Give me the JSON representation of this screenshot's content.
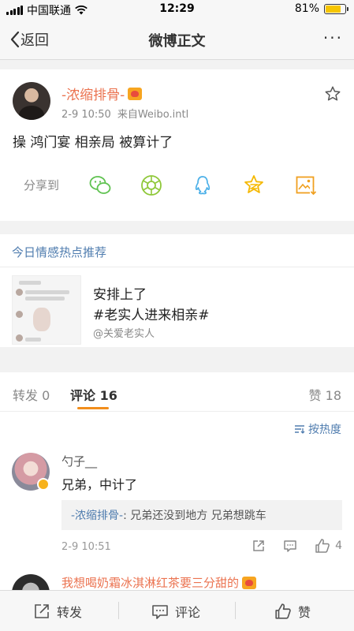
{
  "status_bar": {
    "carrier": "中国联通",
    "time": "12:29",
    "battery": "81%",
    "battery_level": 0.81
  },
  "nav": {
    "back_label": "返回",
    "title": "微博正文",
    "more": "···"
  },
  "post": {
    "username": "-浓缩排骨-",
    "time": "2-9 10:50",
    "source": "来自Weibo.intl",
    "text": "操 鸿门宴 相亲局 被算计了",
    "share_label": "分享到",
    "share_icons": [
      "wechat-icon",
      "moments-icon",
      "qq-icon",
      "qzone-icon",
      "save-image-icon"
    ]
  },
  "recommend": {
    "header": "今日情感热点推荐",
    "line1": "安排上了",
    "line2": "#老实人进来相亲#",
    "author": "@关爱老实人"
  },
  "tabs": {
    "repost_label": "转发",
    "repost_count": "0",
    "comment_label": "评论",
    "comment_count": "16",
    "like_label": "赞",
    "like_count": "18"
  },
  "comments": {
    "sort_label": "按热度",
    "items": [
      {
        "username": "勺子__",
        "text": "兄弟，中计了",
        "reply_name": "-浓缩排骨-",
        "reply_text": ": 兄弟还没到地方 兄弟想跳车",
        "time": "2-9 10:51",
        "likes": "4"
      },
      {
        "username": "我想喝奶霜冰淇淋红茶要三分甜的"
      }
    ]
  },
  "bottom_bar": {
    "repost": "转发",
    "comment": "评论",
    "like": "赞"
  },
  "colors": {
    "orange_name": "#eb7350",
    "link_blue": "#507daf",
    "tab_underline": "#f28e1c",
    "battery": "#f6c500"
  }
}
